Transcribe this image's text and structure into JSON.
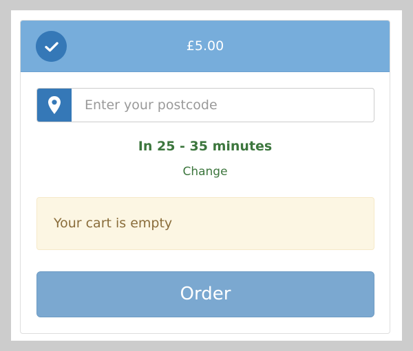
{
  "header": {
    "price": "£5.00",
    "status_icon": "check-icon"
  },
  "postcode": {
    "icon": "map-marker-icon",
    "placeholder": "Enter your postcode",
    "value": ""
  },
  "delivery": {
    "eta": "In 25 - 35 minutes",
    "change_label": "Change"
  },
  "cart": {
    "empty_message": "Your cart is empty"
  },
  "actions": {
    "order_label": "Order"
  },
  "colors": {
    "header_bg": "#77addb",
    "accent_blue": "#3578b7",
    "success_green": "#3c763d",
    "warning_bg": "#fcf6e3",
    "warning_text": "#8a6d3b",
    "button_bg": "#7ba8d0"
  }
}
